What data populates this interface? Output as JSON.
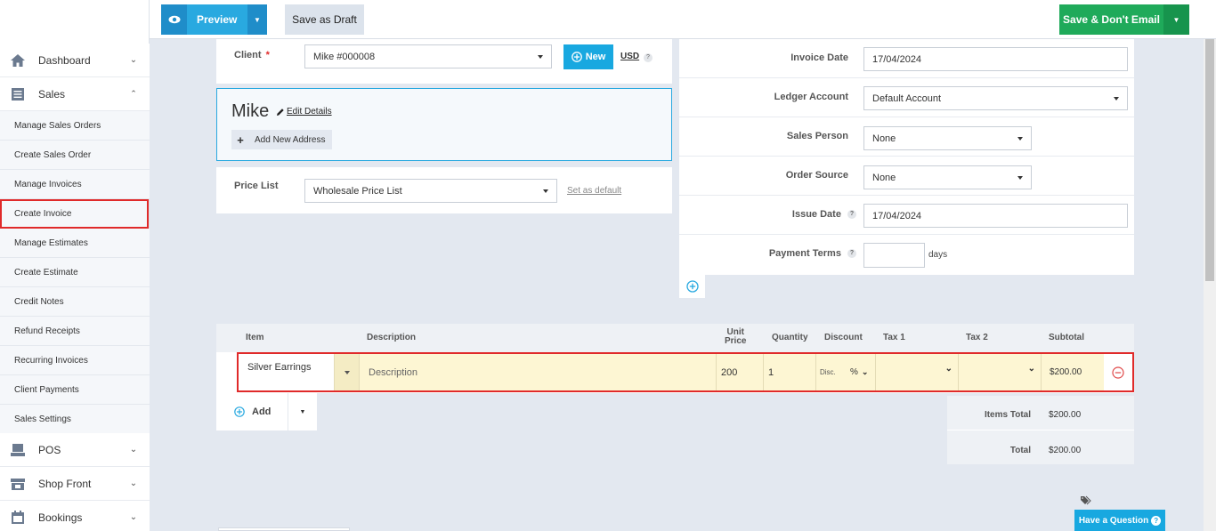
{
  "toolbar": {
    "preview_label": "Preview",
    "draft_label": "Save as Draft",
    "save_label": "Save & Don't Email"
  },
  "sidebar": {
    "dashboard": "Dashboard",
    "sales": "Sales",
    "sub_items": [
      "Manage Sales Orders",
      "Create Sales Order",
      "Manage Invoices",
      "Create Invoice",
      "Manage Estimates",
      "Create Estimate",
      "Credit Notes",
      "Refund Receipts",
      "Recurring Invoices",
      "Client Payments",
      "Sales Settings"
    ],
    "pos": "POS",
    "shop_front": "Shop Front",
    "bookings": "Bookings"
  },
  "client": {
    "label": "Client",
    "required_mark": "*",
    "value": "Mike #000008",
    "new_label": "New",
    "currency": "USD"
  },
  "client_card": {
    "name": "Mike",
    "edit_label": "Edit Details",
    "add_address_label": "Add New Address"
  },
  "price_list": {
    "label": "Price List",
    "value": "Wholesale Price List",
    "set_default_label": "Set as default"
  },
  "invoice_meta": {
    "invoice_date_label": "Invoice Date",
    "invoice_date": "17/04/2024",
    "ledger_label": "Ledger Account",
    "ledger_value": "Default Account",
    "sales_person_label": "Sales Person",
    "sales_person_value": "None",
    "order_source_label": "Order Source",
    "order_source_value": "None",
    "issue_date_label": "Issue Date",
    "issue_date": "17/04/2024",
    "payment_terms_label": "Payment Terms",
    "payment_terms_value": "",
    "days_label": "days"
  },
  "items_table": {
    "headers": {
      "item": "Item",
      "description": "Description",
      "unit_price_1": "Unit",
      "unit_price_2": "Price",
      "quantity": "Quantity",
      "discount": "Discount",
      "tax1": "Tax 1",
      "tax2": "Tax 2",
      "subtotal": "Subtotal"
    },
    "row": {
      "item": "Silver Earrings",
      "description_placeholder": "Description",
      "unit_price": "200",
      "quantity": "1",
      "disc_label": "Disc.",
      "disc_type": "%",
      "subtotal": "$200.00"
    },
    "add_label": "Add"
  },
  "totals": {
    "items_total_label": "Items Total",
    "items_total": "$200.00",
    "total_label": "Total",
    "total": "$200.00"
  },
  "help": {
    "label": "Have a Question"
  }
}
